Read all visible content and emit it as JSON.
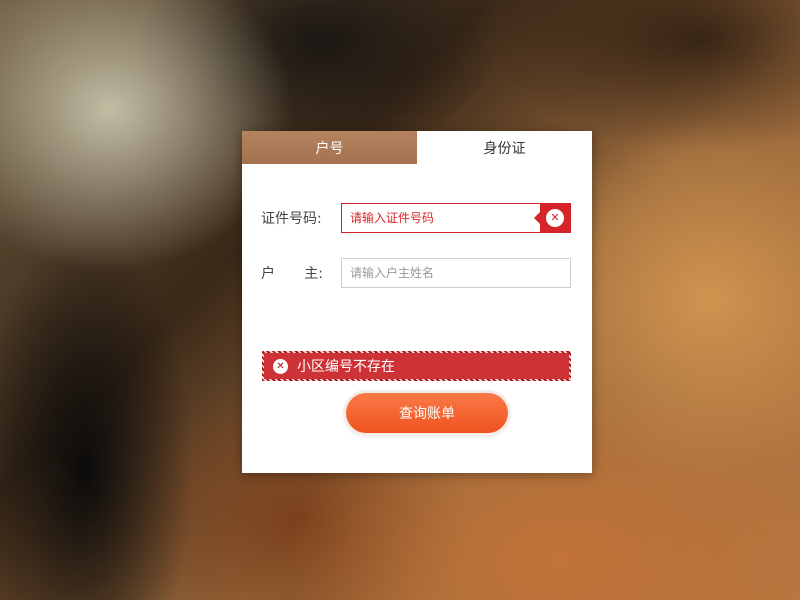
{
  "tabs": [
    {
      "label": "户号",
      "active": false
    },
    {
      "label": "身份证",
      "active": true
    }
  ],
  "form": {
    "id_number": {
      "label": "证件号码:",
      "placeholder": "请输入证件号码",
      "value": "",
      "error": true
    },
    "owner": {
      "label_char1": "户",
      "label_char2": "主:",
      "placeholder": "请输入户主姓名",
      "value": ""
    }
  },
  "alert": {
    "message": "小区编号不存在",
    "icon": "close-circle-icon"
  },
  "submit_label": "查询账单",
  "colors": {
    "tab_inactive": "#a4724f",
    "error": "#d6252a",
    "alert_bg": "#cd3236",
    "button": "#f2602b"
  }
}
